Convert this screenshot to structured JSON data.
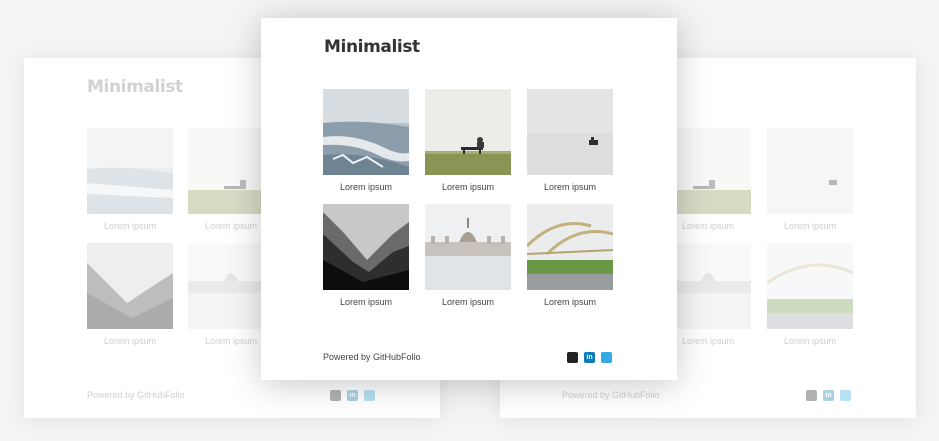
{
  "site": {
    "title": "Minimalist",
    "footer": "Powered by GitHubFolio",
    "caption": "Lorem ipsum"
  },
  "gallery": [
    {
      "caption": "Lorem ipsum",
      "image": "frozen-shore"
    },
    {
      "caption": "Lorem ipsum",
      "image": "bench-field"
    },
    {
      "caption": "Lorem ipsum",
      "image": "boat-lake"
    },
    {
      "caption": "Lorem ipsum",
      "image": "misty-valley"
    },
    {
      "caption": "Lorem ipsum",
      "image": "parliament-building"
    },
    {
      "caption": "Lorem ipsum",
      "image": "arched-bridge"
    }
  ],
  "social": [
    {
      "name": "github-icon",
      "glyph": ""
    },
    {
      "name": "linkedin-icon",
      "glyph": "in"
    },
    {
      "name": "twitter-icon",
      "glyph": ""
    }
  ]
}
